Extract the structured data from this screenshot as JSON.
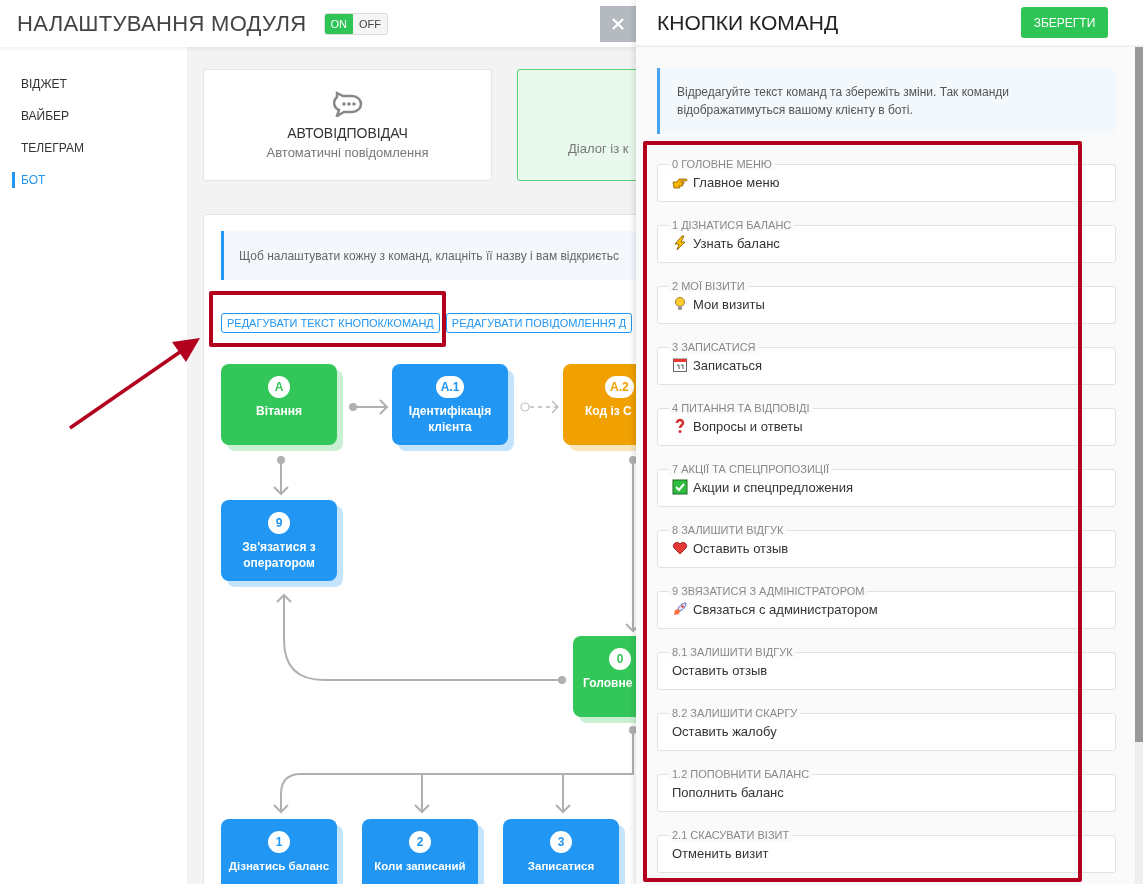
{
  "header": {
    "title": "НАЛАШТУВАННЯ МОДУЛЯ",
    "toggle": {
      "on_label": "ON",
      "off_label": "OFF",
      "on": true
    }
  },
  "sidebar": {
    "items": [
      {
        "label": "ВІДЖЕТ",
        "selected": false
      },
      {
        "label": "ВАЙБЕР",
        "selected": false
      },
      {
        "label": "ТЕЛЕГРАМ",
        "selected": false
      },
      {
        "label": "БОТ",
        "selected": true
      }
    ]
  },
  "cards": [
    {
      "title": "АВТОВІДПОВІДАЧ",
      "subtitle": "Автоматичні повідомлення",
      "selected": false
    },
    {
      "subtitle": "Діалог із к",
      "selected": true
    }
  ],
  "bot_panel": {
    "info": "Щоб налаштувати кожну з команд, клацніть її назву і вам відкриєтьс",
    "buttons": [
      "РЕДАГУВАТИ ТЕКСТ КНОПОК/КОМАНД",
      "РЕДАГУВАТИ ПОВІДОМЛЕННЯ Д"
    ],
    "nodes": [
      {
        "badge": "A",
        "label": "Вітання",
        "color": "#33c759"
      },
      {
        "badge": "A.1",
        "label": "Ідентифікація клієнта",
        "color": "#2196f3"
      },
      {
        "badge": "A.2",
        "label": "Код із С",
        "color": "#f0a000"
      },
      {
        "badge": "9",
        "label": "Зв'язатися з оператором",
        "color": "#2196f3"
      },
      {
        "badge": "0",
        "label": "Головне",
        "color": "#33c759"
      },
      {
        "badge": "1",
        "label": "Дізнатись баланс",
        "color": "#2196f3"
      },
      {
        "badge": "2",
        "label": "Коли записаний",
        "color": "#2196f3"
      },
      {
        "badge": "3",
        "label": "Записатися",
        "color": "#2196f3"
      }
    ]
  },
  "drawer": {
    "title": "КНОПКИ КОМАНД",
    "save": "ЗБЕРЕГТИ",
    "info": "Відредагуйте текст команд та збережіть зміни. Так команди відображатимуться вашому клієнту в боті.",
    "fields": [
      {
        "label": "0 ГОЛОВНЕ МЕНЮ",
        "value": "Главное меню",
        "kind": "hand"
      },
      {
        "label": "1 ДІЗНАТИСЯ БАЛАНС",
        "value": "Узнать баланс",
        "kind": "bolt"
      },
      {
        "label": "2 МОЇ ВІЗИТИ",
        "value": "Мои визиты",
        "kind": "bulb"
      },
      {
        "label": "3 ЗАПИСАТИСЯ",
        "value": "Записаться",
        "kind": "calendar"
      },
      {
        "label": "4 ПИТАННЯ ТА ВІДПОВІДІ",
        "value": "Вопросы и ответы",
        "kind": "question"
      },
      {
        "label": "7 АКЦІЇ ТА СПЕЦПРОПОЗИЦІЇ",
        "value": "Акции и спецпредложения",
        "kind": "check"
      },
      {
        "label": "8 ЗАЛИШИТИ ВІДГУК",
        "value": "Оставить отзыв",
        "kind": "heart"
      },
      {
        "label": "9 ЗВЯЗАТИСЯ З АДМІНІСТРАТОРОМ",
        "value": "Связаться с администратором",
        "kind": "rocket"
      },
      {
        "label": "8.1 ЗАЛИШИТИ ВІДГУК",
        "value": "Оставить отзыв"
      },
      {
        "label": "8.2 ЗАЛИШИТИ СКАРГУ",
        "value": "Оставить жалобу"
      },
      {
        "label": "1.2 ПОПОВНИТИ БАЛАНС",
        "value": "Пополнить баланс"
      },
      {
        "label": "2.1 СКАСУВАТИ ВІЗИТ",
        "value": "Отменить визит"
      }
    ]
  }
}
